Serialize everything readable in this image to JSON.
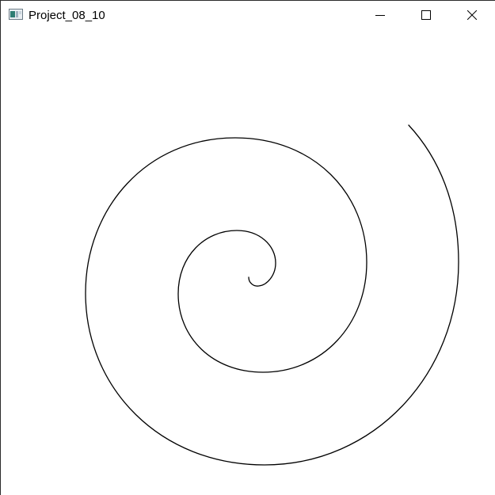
{
  "window": {
    "title": "Project_08_10",
    "icon": "application-window-icon",
    "controls": [
      "minimize-icon",
      "maximize-icon",
      "close-icon"
    ]
  },
  "canvas": {
    "shape": "spiral",
    "stroke_color": "#000000",
    "background_color": "#ffffff"
  }
}
